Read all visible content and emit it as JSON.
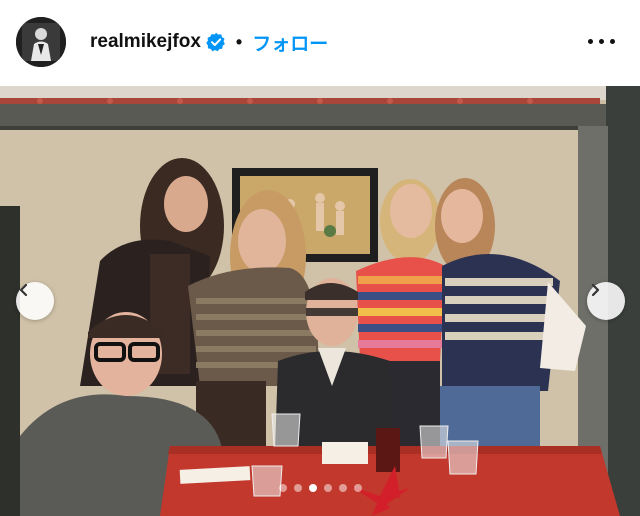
{
  "post": {
    "username": "realmikejfox",
    "separator": "•",
    "follow_label": "フォロー",
    "verified": true
  },
  "carousel": {
    "slide_count": 6,
    "active_index": 2
  },
  "icons": {
    "verified": "verified-badge-icon",
    "more": "more-options-icon",
    "prev": "chevron-left-icon",
    "next": "chevron-right-icon"
  },
  "colors": {
    "follow_blue": "#0095f6",
    "verified_blue": "#0095f6"
  }
}
